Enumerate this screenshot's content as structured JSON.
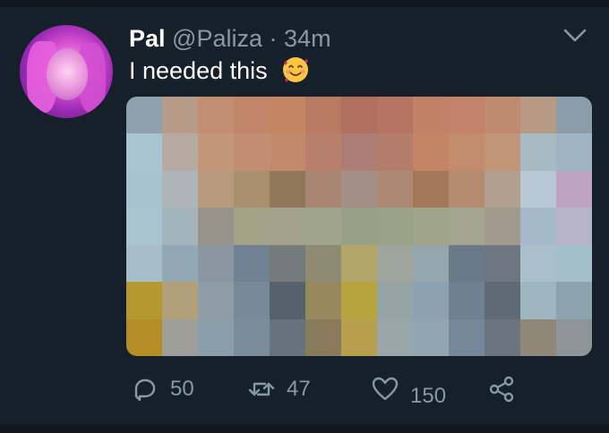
{
  "tweet": {
    "display_name": "Pal",
    "handle": "@Paliza",
    "separator": "·",
    "time": "34m",
    "text": "I needed this",
    "emoji": "smiling-face-with-hearts",
    "media_state": "pixelated"
  },
  "actions": {
    "reply_count": "50",
    "retweet_count": "47",
    "like_count": "150"
  },
  "icons": {
    "more": "chevron-down-icon",
    "reply": "reply-icon",
    "retweet": "retweet-icon",
    "like": "heart-icon",
    "share": "share-icon"
  },
  "colors": {
    "background": "#15202b",
    "secondary_text": "#8899a6",
    "primary_text": "#ffffff"
  }
}
